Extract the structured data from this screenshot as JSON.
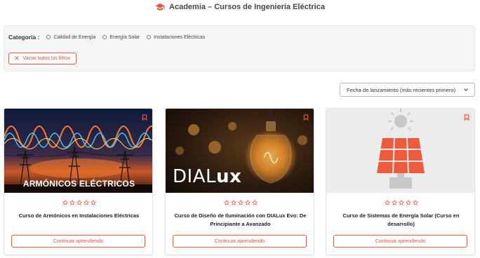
{
  "header": {
    "title": "Academia – Cursos de Ingeniería Eléctrica",
    "icon": "graduation-cap-icon",
    "icon_color": "#e9573f"
  },
  "filters": {
    "category_label": "Categoría :",
    "options": [
      "Calidad de Energía",
      "Energía Solar",
      "Instalaciones Eléctricas"
    ],
    "clear_label": "Vaciar todos los filtros"
  },
  "sort": {
    "selected": "Fecha de lanzamiento (más recientes primero)"
  },
  "courses": [
    {
      "title": "Curso de Armónicos en Instalaciones Eléctricas",
      "thumb_caption": "ARMÓNICOS ELÉCTRICOS",
      "cta": "Continuar aprendiendo",
      "rating": 0
    },
    {
      "title": "Curso de Diseño de Iluminación con DIALux Evo: De Principiante a Avanzado",
      "thumb_caption_a": "DIAL",
      "thumb_caption_b": "ux",
      "cta": "Continuar aprendiendo",
      "rating": 0
    },
    {
      "title": "Curso de Sistemas de Energía Solar (Curso en desarrollo)",
      "cta": "Continuar aprendiendo",
      "rating": 0
    }
  ],
  "colors": {
    "accent": "#e9573f"
  }
}
